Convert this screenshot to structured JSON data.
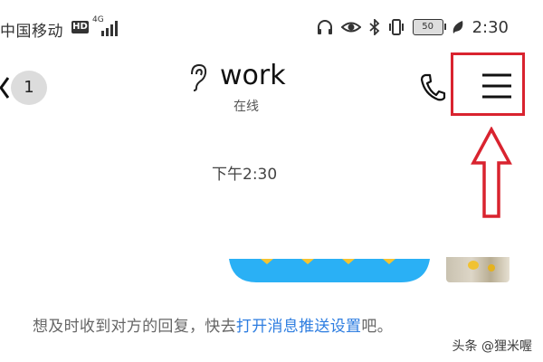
{
  "status_bar": {
    "carrier": "中国移动",
    "hd_badge": "HD",
    "network_type": "4G",
    "battery": "50",
    "time": "2:30"
  },
  "header": {
    "unread_count": "1",
    "title": "work",
    "status": "在线"
  },
  "chat": {
    "timestamp": "下午2:30"
  },
  "notice": {
    "prefix": "想及时收到对方的回复，快去",
    "link": "打开消息推送设置",
    "suffix": "吧。"
  },
  "watermark": "头条 @狸米喔",
  "colors": {
    "highlight": "#d9232f",
    "link": "#2d7de0",
    "banner": "#2ab0f5"
  }
}
